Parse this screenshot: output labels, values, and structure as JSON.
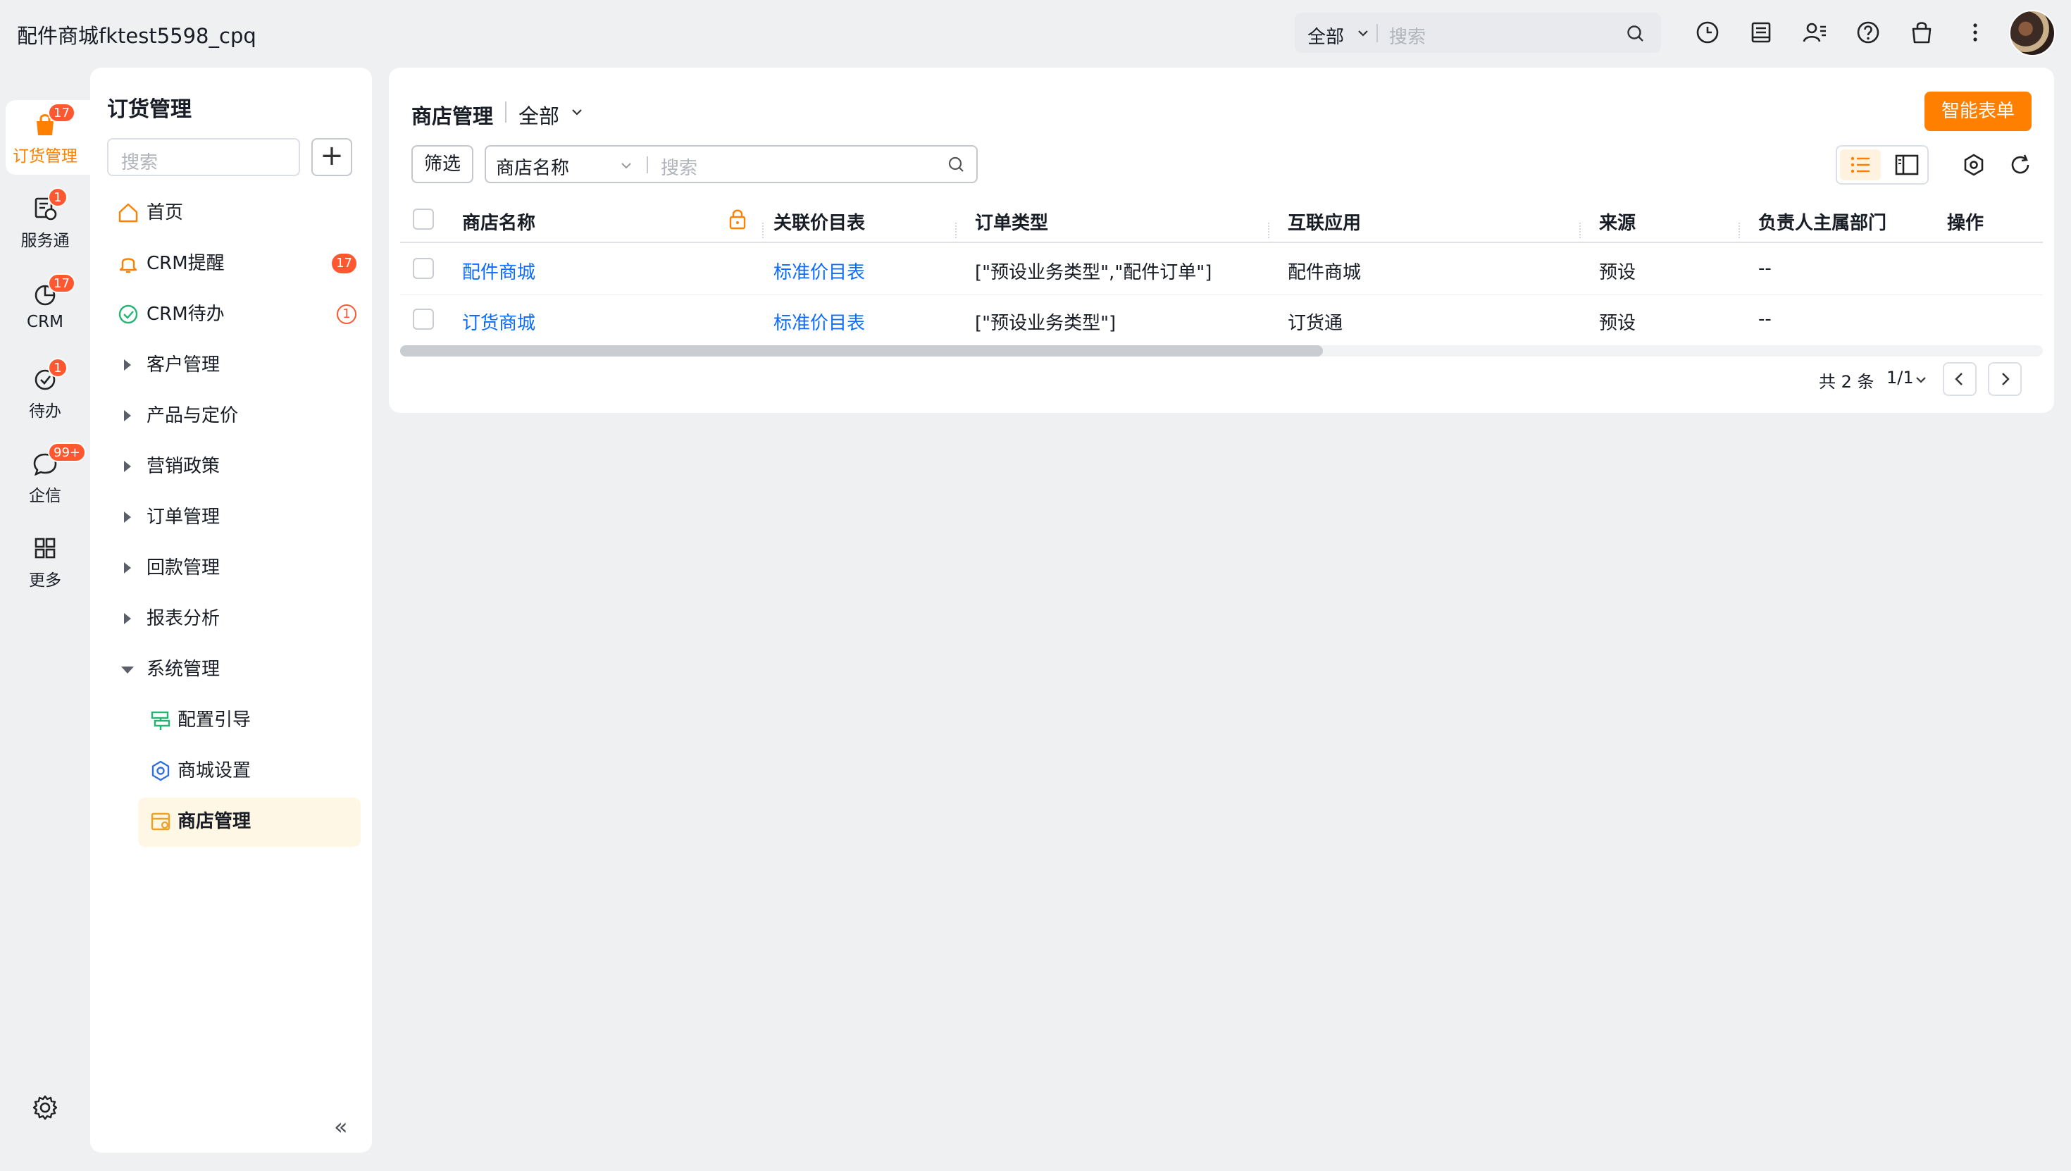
{
  "app": {
    "title": "配件商城fktest5598_cpq"
  },
  "topbar": {
    "scope": "全部",
    "search_placeholder": "搜索",
    "icons": [
      "history-icon",
      "notebook-icon",
      "contacts-icon",
      "help-icon",
      "bag-icon",
      "more-icon"
    ]
  },
  "rail": {
    "items": [
      {
        "label": "订货管理",
        "badge": "17",
        "icon": "order-bag-icon",
        "active": true
      },
      {
        "label": "服务通",
        "badge": "1",
        "icon": "service-icon"
      },
      {
        "label": "CRM",
        "badge": "17",
        "icon": "crm-chart-icon"
      },
      {
        "label": "待办",
        "badge": "1",
        "icon": "todo-check-icon"
      },
      {
        "label": "企信",
        "badge": "99+",
        "icon": "chat-bubble-icon"
      },
      {
        "label": "更多",
        "icon": "grid-icon"
      }
    ]
  },
  "sidebar": {
    "title": "订货管理",
    "search_placeholder": "搜索",
    "add_label": "+",
    "items": [
      {
        "label": "首页"
      },
      {
        "label": "CRM提醒",
        "badge": "17"
      },
      {
        "label": "CRM待办",
        "badge": "1"
      },
      {
        "label": "客户管理"
      },
      {
        "label": "产品与定价"
      },
      {
        "label": "营销政策"
      },
      {
        "label": "订单管理"
      },
      {
        "label": "回款管理"
      },
      {
        "label": "报表分析"
      },
      {
        "label": "系统管理"
      }
    ],
    "sub_items": [
      {
        "label": "配置引导"
      },
      {
        "label": "商城设置"
      },
      {
        "label": "商店管理",
        "active": true
      }
    ],
    "collapse_label": "«"
  },
  "main": {
    "title": "商店管理",
    "scope": "全部",
    "smart_form_label": "智能表单",
    "filter_label": "筛选",
    "search_field": "商店名称",
    "search_placeholder": "搜索",
    "columns": [
      "商店名称",
      "关联价目表",
      "订单类型",
      "互联应用",
      "来源",
      "负责人主属部门",
      "操作"
    ],
    "rows": [
      {
        "name": "配件商城",
        "pricebook": "标准价目表",
        "order_type": "[\"预设业务类型\",\"配件订单\"]",
        "app": "配件商城",
        "source": "预设",
        "dept": "--"
      },
      {
        "name": "订货商城",
        "pricebook": "标准价目表",
        "order_type": "[\"预设业务类型\"]",
        "app": "订货通",
        "source": "预设",
        "dept": "--"
      }
    ],
    "pager": {
      "total": "共 2 条",
      "page": "1/1"
    }
  },
  "colors": {
    "accent": "#ff8000",
    "badge": "#ff5730",
    "link": "#0c6cff"
  }
}
